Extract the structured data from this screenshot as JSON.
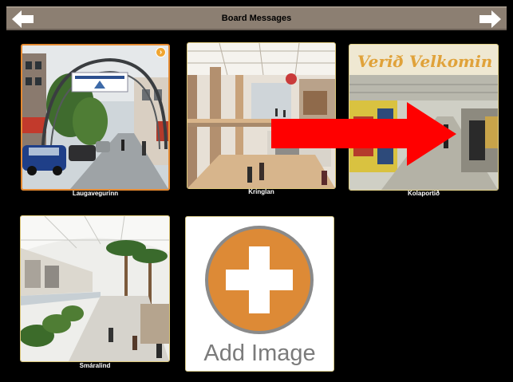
{
  "header": {
    "title": "Board Messages",
    "prev_icon": "arrow-left-icon",
    "next_icon": "arrow-right-icon"
  },
  "tiles": [
    {
      "caption": "Laugavegurinn",
      "image": "street-with-arch-photo",
      "badge_icon": "arrow-right-icon",
      "selected": true
    },
    {
      "caption": "Kringlan",
      "image": "mall-interior-photo"
    },
    {
      "caption": "Kolaportið",
      "image": "indoor-market-photo",
      "sign": "Verið Velkomin"
    },
    {
      "caption": "Smáralind",
      "image": "mall-atrium-photo"
    }
  ],
  "add_tile": {
    "label": "Add Image",
    "icon": "plus-icon"
  },
  "overlay": {
    "icon": "red-arrow-icon"
  },
  "colors": {
    "header_bg": "#8c7f72",
    "accent_orange": "#e58a32",
    "arrow_red": "#ff0000",
    "background": "#000000"
  }
}
